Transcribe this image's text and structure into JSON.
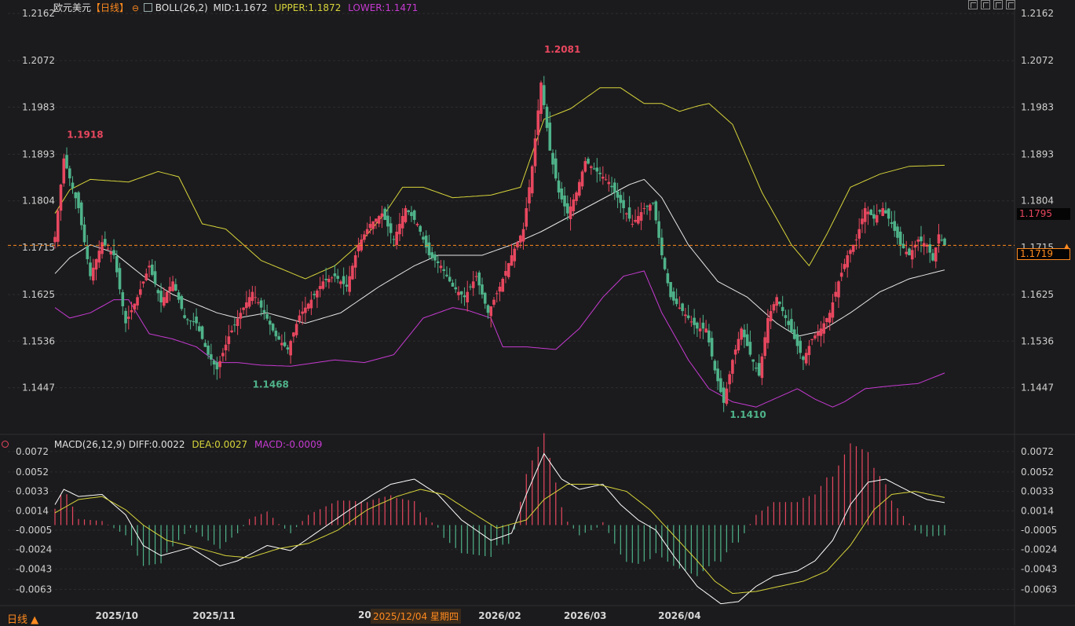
{
  "header": {
    "symbol": "欧元美元",
    "period": "【日线】",
    "indicator": "BOLL(26,2)",
    "mid": "MID:1.1672",
    "upper": "UPPER:1.1872",
    "lower": "LOWER:1.1471"
  },
  "macd_header": {
    "name": "MACD(26,12,9)",
    "diff": "DIFF:0.0022",
    "dea": "DEA:0.0027",
    "macd": "MACD:-0.0009"
  },
  "price_axis": {
    "ticks": [
      "1.2162",
      "1.2072",
      "1.1983",
      "1.1893",
      "1.1804",
      "1.1715",
      "1.1625",
      "1.1536",
      "1.1447"
    ],
    "values": [
      1.2162,
      1.2072,
      1.1983,
      1.1893,
      1.1804,
      1.1715,
      1.1625,
      1.1536,
      1.1447
    ]
  },
  "macd_axis": {
    "ticks": [
      "0.0072",
      "0.0052",
      "0.0033",
      "0.0014",
      "-0.0005",
      "-0.0024",
      "-0.0043",
      "-0.0063"
    ],
    "values": [
      0.0072,
      0.0052,
      0.0033,
      0.0014,
      -0.0005,
      -0.0024,
      -0.0043,
      -0.0063
    ]
  },
  "current": {
    "price_label": "1.1795",
    "last_label": "1.1719",
    "last": 1.1719
  },
  "annotations": [
    {
      "text": "1.1918",
      "value": 1.1918,
      "index": 3,
      "kind": "high"
    },
    {
      "text": "1.1468",
      "value": 1.1468,
      "index": 66,
      "kind": "low"
    },
    {
      "text": "1.2081",
      "value": 1.2081,
      "index": 165,
      "kind": "high"
    },
    {
      "text": "1.1410",
      "value": 1.141,
      "index": 228,
      "kind": "low"
    }
  ],
  "x_axis": {
    "labels": [
      {
        "text": "2025/10",
        "index": 21
      },
      {
        "text": "2025/11",
        "index": 54
      },
      {
        "text": "2026/01",
        "index": 120
      },
      {
        "text": "2026/02",
        "index": 151
      },
      {
        "text": "2026/03",
        "index": 180
      },
      {
        "text": "2026/04",
        "index": 212
      }
    ],
    "hover_date": "2025/12/04 星期四",
    "hover_prefix": "20"
  },
  "footer": {
    "period_button": "日线 ▲"
  },
  "colors": {
    "up": "#e8475f",
    "down": "#4fb38a",
    "mid": "#e6e6e6",
    "upper": "#d7d43a",
    "lower": "#c63ad1",
    "dea": "#d7d43a",
    "accent": "#ff8a1e"
  },
  "chart_data": {
    "type": "candlestick",
    "anchors_close": [
      [
        0,
        1.1735
      ],
      [
        3,
        1.1885
      ],
      [
        8,
        1.179
      ],
      [
        12,
        1.166
      ],
      [
        16,
        1.1725
      ],
      [
        20,
        1.17
      ],
      [
        24,
        1.157
      ],
      [
        28,
        1.162
      ],
      [
        32,
        1.168
      ],
      [
        36,
        1.161
      ],
      [
        40,
        1.165
      ],
      [
        44,
        1.158
      ],
      [
        48,
        1.157
      ],
      [
        52,
        1.151
      ],
      [
        55,
        1.1482
      ],
      [
        59,
        1.1545
      ],
      [
        63,
        1.159
      ],
      [
        67,
        1.163
      ],
      [
        71,
        1.159
      ],
      [
        75,
        1.1545
      ],
      [
        79,
        1.152
      ],
      [
        83,
        1.1585
      ],
      [
        87,
        1.1615
      ],
      [
        91,
        1.165
      ],
      [
        95,
        1.166
      ],
      [
        99,
        1.164
      ],
      [
        103,
        1.172
      ],
      [
        107,
        1.176
      ],
      [
        111,
        1.178
      ],
      [
        115,
        1.173
      ],
      [
        119,
        1.179
      ],
      [
        123,
        1.176
      ],
      [
        127,
        1.17
      ],
      [
        131,
        1.168
      ],
      [
        135,
        1.164
      ],
      [
        139,
        1.162
      ],
      [
        143,
        1.166
      ],
      [
        147,
        1.159
      ],
      [
        151,
        1.164
      ],
      [
        155,
        1.17
      ],
      [
        159,
        1.175
      ],
      [
        162,
        1.187
      ],
      [
        165,
        1.203
      ],
      [
        168,
        1.19
      ],
      [
        171,
        1.182
      ],
      [
        174,
        1.178
      ],
      [
        177,
        1.182
      ],
      [
        180,
        1.188
      ],
      [
        184,
        1.186
      ],
      [
        188,
        1.184
      ],
      [
        192,
        1.18
      ],
      [
        196,
        1.176
      ],
      [
        200,
        1.179
      ],
      [
        203,
        1.18
      ],
      [
        206,
        1.17
      ],
      [
        209,
        1.162
      ],
      [
        212,
        1.16
      ],
      [
        215,
        1.158
      ],
      [
        218,
        1.156
      ],
      [
        221,
        1.156
      ],
      [
        224,
        1.148
      ],
      [
        227,
        1.1418
      ],
      [
        230,
        1.15
      ],
      [
        233,
        1.156
      ],
      [
        236,
        1.151
      ],
      [
        239,
        1.147
      ],
      [
        242,
        1.158
      ],
      [
        245,
        1.162
      ],
      [
        248,
        1.158
      ],
      [
        251,
        1.154
      ],
      [
        254,
        1.15
      ],
      [
        257,
        1.154
      ],
      [
        260,
        1.156
      ],
      [
        263,
        1.159
      ],
      [
        266,
        1.165
      ],
      [
        269,
        1.17
      ],
      [
        272,
        1.173
      ],
      [
        275,
        1.179
      ],
      [
        278,
        1.177
      ],
      [
        281,
        1.179
      ],
      [
        284,
        1.176
      ],
      [
        287,
        1.172
      ],
      [
        290,
        1.17
      ],
      [
        293,
        1.173
      ],
      [
        296,
        1.172
      ],
      [
        298,
        1.169
      ],
      [
        300,
        1.174
      ],
      [
        302,
        1.1719
      ]
    ],
    "anchors_mid": [
      [
        0,
        1.1665
      ],
      [
        5,
        1.1695
      ],
      [
        12,
        1.172
      ],
      [
        20,
        1.1705
      ],
      [
        30,
        1.166
      ],
      [
        40,
        1.1625
      ],
      [
        55,
        1.159
      ],
      [
        62,
        1.158
      ],
      [
        72,
        1.159
      ],
      [
        85,
        1.157
      ],
      [
        97,
        1.159
      ],
      [
        110,
        1.164
      ],
      [
        122,
        1.168
      ],
      [
        130,
        1.17
      ],
      [
        145,
        1.17
      ],
      [
        155,
        1.172
      ],
      [
        165,
        1.1745
      ],
      [
        180,
        1.179
      ],
      [
        195,
        1.1835
      ],
      [
        200,
        1.1845
      ],
      [
        206,
        1.181
      ],
      [
        215,
        1.172
      ],
      [
        225,
        1.165
      ],
      [
        235,
        1.162
      ],
      [
        245,
        1.157
      ],
      [
        252,
        1.1545
      ],
      [
        260,
        1.1555
      ],
      [
        270,
        1.159
      ],
      [
        280,
        1.163
      ],
      [
        290,
        1.1655
      ],
      [
        302,
        1.1672
      ]
    ],
    "anchors_upper": [
      [
        0,
        1.178
      ],
      [
        5,
        1.1825
      ],
      [
        12,
        1.1845
      ],
      [
        25,
        1.184
      ],
      [
        35,
        1.186
      ],
      [
        42,
        1.185
      ],
      [
        50,
        1.176
      ],
      [
        58,
        1.175
      ],
      [
        70,
        1.169
      ],
      [
        85,
        1.1655
      ],
      [
        95,
        1.168
      ],
      [
        103,
        1.172
      ],
      [
        112,
        1.178
      ],
      [
        118,
        1.183
      ],
      [
        125,
        1.183
      ],
      [
        135,
        1.181
      ],
      [
        148,
        1.1815
      ],
      [
        158,
        1.183
      ],
      [
        166,
        1.196
      ],
      [
        175,
        1.198
      ],
      [
        185,
        1.202
      ],
      [
        192,
        1.202
      ],
      [
        200,
        1.199
      ],
      [
        206,
        1.199
      ],
      [
        212,
        1.1975
      ],
      [
        218,
        1.1985
      ],
      [
        222,
        1.199
      ],
      [
        230,
        1.195
      ],
      [
        240,
        1.182
      ],
      [
        250,
        1.172
      ],
      [
        256,
        1.168
      ],
      [
        262,
        1.174
      ],
      [
        270,
        1.183
      ],
      [
        280,
        1.1855
      ],
      [
        290,
        1.187
      ],
      [
        302,
        1.1872
      ]
    ],
    "anchors_lower": [
      [
        0,
        1.16
      ],
      [
        5,
        1.158
      ],
      [
        12,
        1.159
      ],
      [
        20,
        1.1615
      ],
      [
        25,
        1.1615
      ],
      [
        32,
        1.155
      ],
      [
        40,
        1.154
      ],
      [
        48,
        1.1525
      ],
      [
        55,
        1.1495
      ],
      [
        62,
        1.1495
      ],
      [
        70,
        1.149
      ],
      [
        80,
        1.1488
      ],
      [
        95,
        1.15
      ],
      [
        105,
        1.1495
      ],
      [
        115,
        1.151
      ],
      [
        125,
        1.158
      ],
      [
        135,
        1.16
      ],
      [
        140,
        1.1595
      ],
      [
        148,
        1.158
      ],
      [
        152,
        1.1525
      ],
      [
        160,
        1.1525
      ],
      [
        170,
        1.152
      ],
      [
        178,
        1.156
      ],
      [
        186,
        1.162
      ],
      [
        193,
        1.166
      ],
      [
        200,
        1.167
      ],
      [
        206,
        1.159
      ],
      [
        215,
        1.15
      ],
      [
        222,
        1.1445
      ],
      [
        230,
        1.142
      ],
      [
        238,
        1.141
      ],
      [
        246,
        1.143
      ],
      [
        252,
        1.1445
      ],
      [
        258,
        1.1425
      ],
      [
        264,
        1.141
      ],
      [
        268,
        1.142
      ],
      [
        275,
        1.1445
      ],
      [
        283,
        1.145
      ],
      [
        293,
        1.1455
      ],
      [
        302,
        1.1475
      ]
    ],
    "anchors_diff": [
      [
        0,
        0.002
      ],
      [
        3,
        0.0035
      ],
      [
        8,
        0.0028
      ],
      [
        16,
        0.003
      ],
      [
        24,
        0.001
      ],
      [
        30,
        -0.002
      ],
      [
        36,
        -0.003
      ],
      [
        46,
        -0.0022
      ],
      [
        56,
        -0.004
      ],
      [
        62,
        -0.0035
      ],
      [
        72,
        -0.002
      ],
      [
        80,
        -0.0025
      ],
      [
        90,
        -0.0005
      ],
      [
        100,
        0.0015
      ],
      [
        108,
        0.003
      ],
      [
        114,
        0.004
      ],
      [
        122,
        0.0045
      ],
      [
        130,
        0.003
      ],
      [
        138,
        0.0005
      ],
      [
        148,
        -0.0015
      ],
      [
        155,
        -0.0008
      ],
      [
        160,
        0.003
      ],
      [
        166,
        0.007
      ],
      [
        172,
        0.0045
      ],
      [
        178,
        0.0035
      ],
      [
        186,
        0.004
      ],
      [
        192,
        0.002
      ],
      [
        198,
        0.0005
      ],
      [
        204,
        -0.0005
      ],
      [
        210,
        -0.003
      ],
      [
        218,
        -0.006
      ],
      [
        226,
        -0.0077
      ],
      [
        232,
        -0.0075
      ],
      [
        238,
        -0.006
      ],
      [
        244,
        -0.005
      ],
      [
        252,
        -0.0045
      ],
      [
        258,
        -0.0035
      ],
      [
        264,
        -0.0015
      ],
      [
        270,
        0.002
      ],
      [
        276,
        0.0042
      ],
      [
        282,
        0.0045
      ],
      [
        290,
        0.0033
      ],
      [
        296,
        0.0025
      ],
      [
        302,
        0.0022
      ]
    ],
    "anchors_dea": [
      [
        0,
        0.0012
      ],
      [
        8,
        0.0025
      ],
      [
        16,
        0.0028
      ],
      [
        24,
        0.0015
      ],
      [
        30,
        0.0
      ],
      [
        38,
        -0.0015
      ],
      [
        48,
        -0.0022
      ],
      [
        58,
        -0.003
      ],
      [
        66,
        -0.0032
      ],
      [
        76,
        -0.0023
      ],
      [
        86,
        -0.0018
      ],
      [
        96,
        -0.0005
      ],
      [
        106,
        0.0015
      ],
      [
        116,
        0.0028
      ],
      [
        124,
        0.0035
      ],
      [
        132,
        0.003
      ],
      [
        140,
        0.0015
      ],
      [
        150,
        -0.0003
      ],
      [
        160,
        0.0005
      ],
      [
        166,
        0.0025
      ],
      [
        174,
        0.004
      ],
      [
        184,
        0.004
      ],
      [
        194,
        0.0033
      ],
      [
        202,
        0.0015
      ],
      [
        210,
        -0.001
      ],
      [
        218,
        -0.0035
      ],
      [
        224,
        -0.0055
      ],
      [
        230,
        -0.0067
      ],
      [
        238,
        -0.0065
      ],
      [
        246,
        -0.006
      ],
      [
        254,
        -0.0055
      ],
      [
        262,
        -0.0045
      ],
      [
        270,
        -0.002
      ],
      [
        278,
        0.0015
      ],
      [
        284,
        0.003
      ],
      [
        292,
        0.0033
      ],
      [
        302,
        0.0027
      ]
    ]
  }
}
